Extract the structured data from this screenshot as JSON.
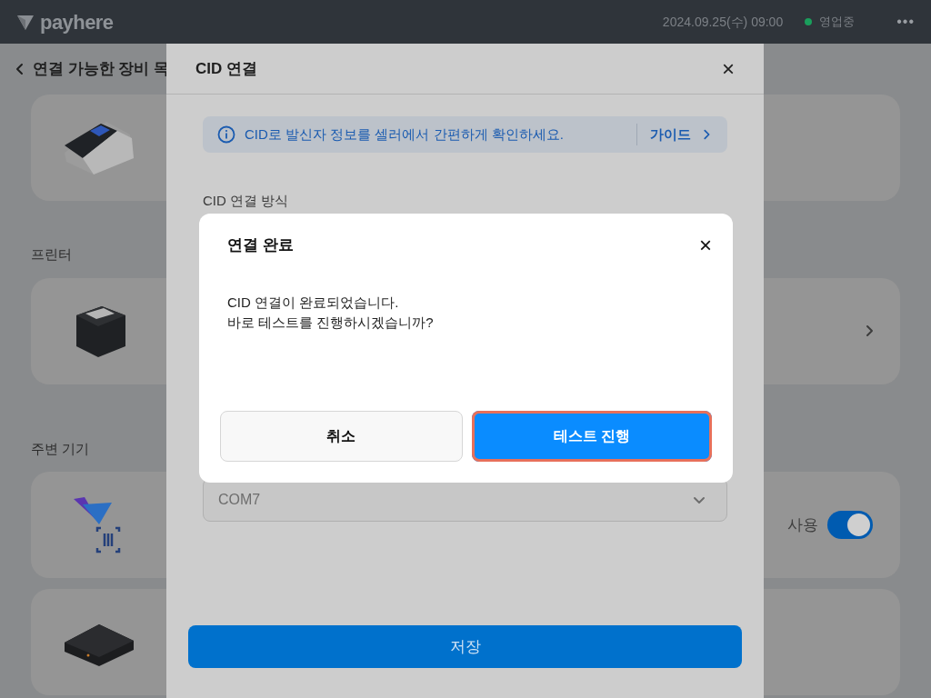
{
  "top_bar": {
    "logo": "payhere",
    "datetime": "2024.09.25(수) 09:00",
    "status": {
      "label": "영업중",
      "color": "#1a9e5c"
    },
    "menu": "•••"
  },
  "page": {
    "back_title": "연결 가능한 장비 목",
    "sections": [
      {
        "devices": [
          {
            "kind": "plain"
          }
        ]
      },
      {
        "title": "프린터",
        "devices": [
          {
            "kind": "chevron"
          }
        ]
      },
      {
        "title": "주변 기기",
        "devices": [
          {
            "kind": "toggle",
            "toggle_label": "사용",
            "on": true
          },
          {
            "kind": "plain"
          }
        ]
      }
    ]
  },
  "sheet": {
    "title": "CID 연결",
    "close": "×",
    "banner": {
      "text": "CID로 발신자 정보를 셀러에서 간편하게 확인하세요.",
      "link": "가이드"
    },
    "method_label": "CID 연결 방식",
    "port_value": "COM7",
    "save": "저장"
  },
  "dialog": {
    "title": "연결 완료",
    "close": "×",
    "message": [
      "CID 연결이 완료되었습니다.",
      "바로 테스트를 진행하시겠습니까?"
    ],
    "buttons": [
      {
        "label": "취소",
        "kind": "secondary",
        "highlighted": false
      },
      {
        "label": "테스트 진행",
        "kind": "primary",
        "highlighted": true
      }
    ]
  }
}
